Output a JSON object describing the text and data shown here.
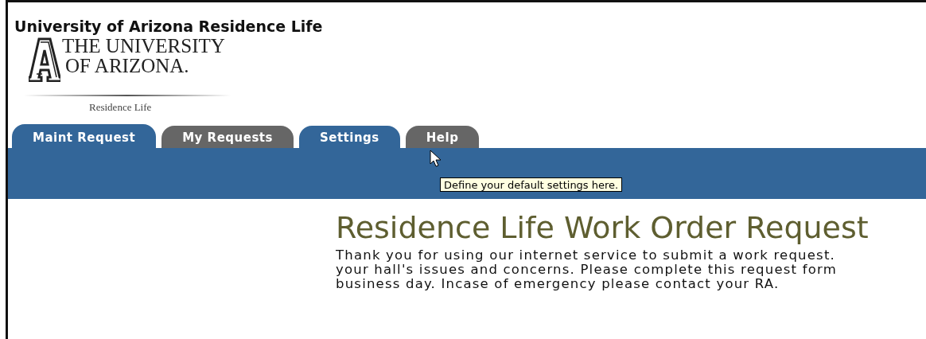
{
  "site_title": "University of Arizona Residence Life",
  "logo": {
    "line_1": "THE UNIVERSITY",
    "line_2": "OF ARIZONA.",
    "subtitle": "Residence Life"
  },
  "tabs": [
    {
      "label": "Maint Request",
      "selected": true,
      "hovered": false
    },
    {
      "label": "My Requests",
      "selected": false,
      "hovered": false
    },
    {
      "label": "Settings",
      "selected": false,
      "hovered": true
    },
    {
      "label": "Help",
      "selected": false,
      "hovered": false
    }
  ],
  "tooltip": "Define your default settings here.",
  "heading": "Residence Life Work Order Request",
  "intro_lines": [
    "Thank you for using our internet service to submit a work request.",
    "your hall's issues and concerns. Please complete this request form",
    "business day. Incase of emergency please contact your RA."
  ]
}
